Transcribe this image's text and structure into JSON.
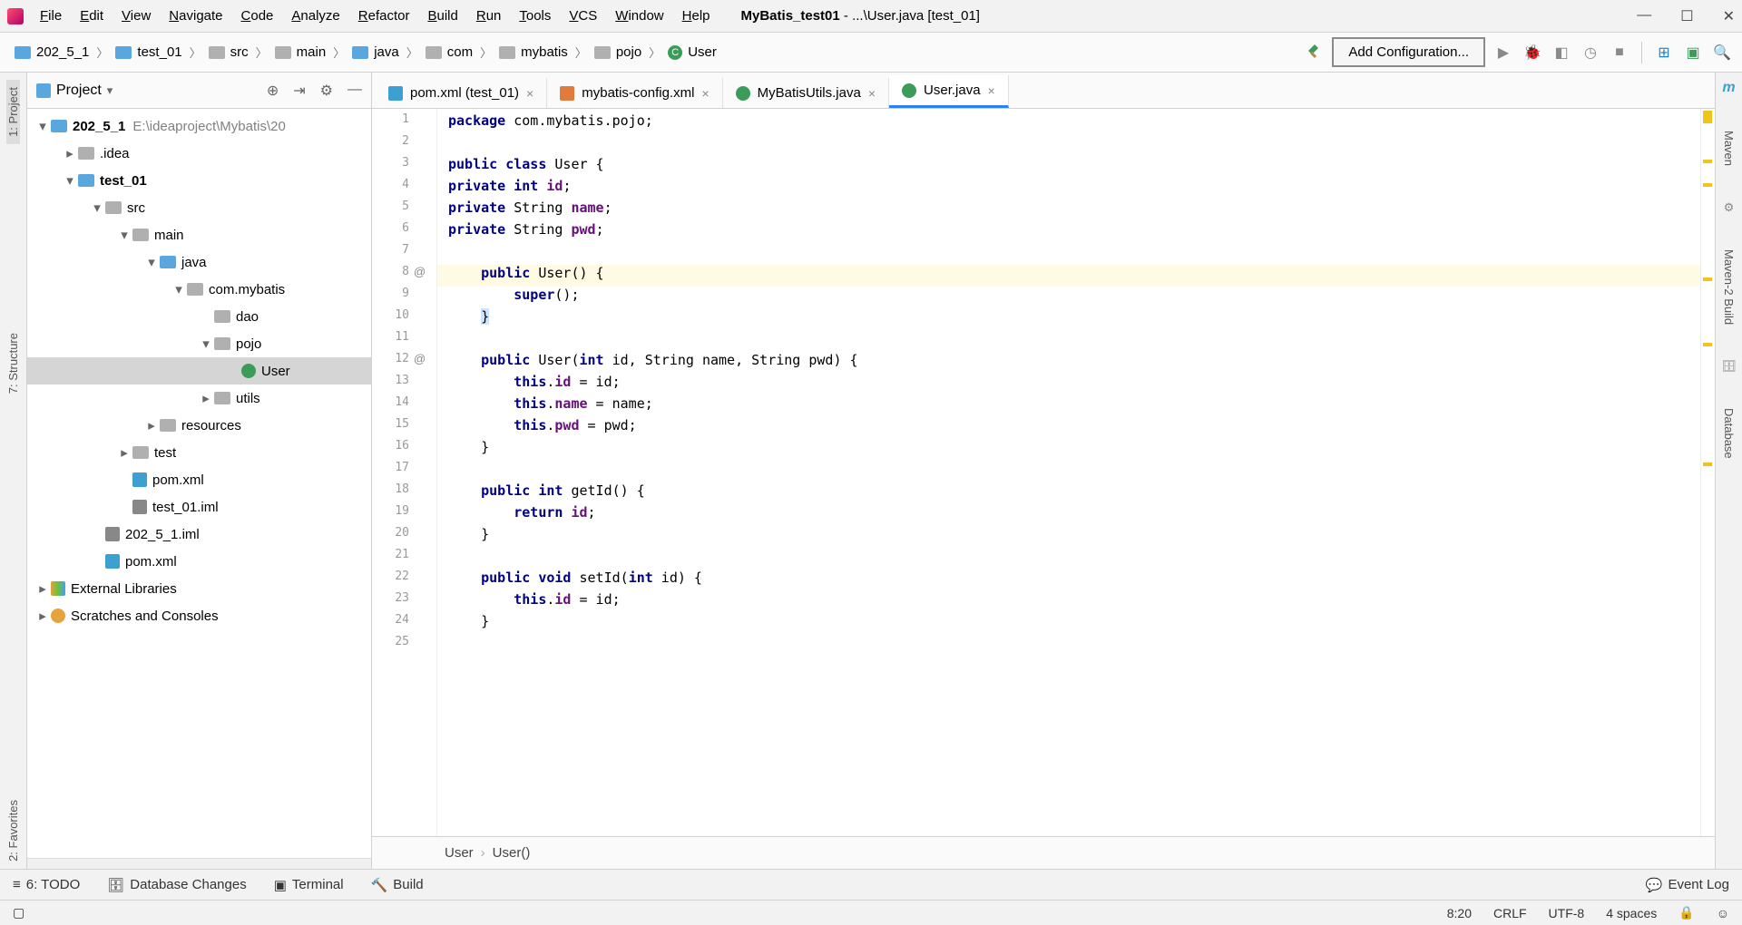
{
  "menu": {
    "items": [
      "File",
      "Edit",
      "View",
      "Navigate",
      "Code",
      "Analyze",
      "Refactor",
      "Build",
      "Run",
      "Tools",
      "VCS",
      "Window",
      "Help"
    ],
    "title_strong": "MyBatis_test01",
    "title_rest": " - ...\\User.java [test_01]"
  },
  "breadcrumb": [
    "202_5_1",
    "test_01",
    "src",
    "main",
    "java",
    "com",
    "mybatis",
    "pojo",
    "User"
  ],
  "toolbar": {
    "config_btn": "Add Configuration..."
  },
  "project": {
    "header": "Project",
    "root_name": "202_5_1",
    "root_hint": "E:\\ideaproject\\Mybatis\\20",
    "tree": [
      {
        "depth": 0,
        "arrow": "▾",
        "name": "202_5_1",
        "bold": true,
        "icon": "folder-blue",
        "hint": "E:\\ideaproject\\Mybatis\\20"
      },
      {
        "depth": 1,
        "arrow": "▸",
        "name": ".idea",
        "icon": "folder"
      },
      {
        "depth": 1,
        "arrow": "▾",
        "name": "test_01",
        "bold": true,
        "icon": "folder-blue"
      },
      {
        "depth": 2,
        "arrow": "▾",
        "name": "src",
        "icon": "folder"
      },
      {
        "depth": 3,
        "arrow": "▾",
        "name": "main",
        "icon": "folder"
      },
      {
        "depth": 4,
        "arrow": "▾",
        "name": "java",
        "icon": "folder-blue"
      },
      {
        "depth": 5,
        "arrow": "▾",
        "name": "com.mybatis",
        "icon": "folder"
      },
      {
        "depth": 6,
        "arrow": "",
        "name": "dao",
        "icon": "folder"
      },
      {
        "depth": 6,
        "arrow": "▾",
        "name": "pojo",
        "icon": "folder"
      },
      {
        "depth": 7,
        "arrow": "",
        "name": "User",
        "icon": "class",
        "selected": true
      },
      {
        "depth": 6,
        "arrow": "▸",
        "name": "utils",
        "icon": "folder"
      },
      {
        "depth": 4,
        "arrow": "▸",
        "name": "resources",
        "icon": "folder"
      },
      {
        "depth": 3,
        "arrow": "▸",
        "name": "test",
        "icon": "folder"
      },
      {
        "depth": 3,
        "arrow": "",
        "name": "pom.xml",
        "icon": "maven"
      },
      {
        "depth": 3,
        "arrow": "",
        "name": "test_01.iml",
        "icon": "iml"
      },
      {
        "depth": 2,
        "arrow": "",
        "name": "202_5_1.iml",
        "icon": "iml"
      },
      {
        "depth": 2,
        "arrow": "",
        "name": "pom.xml",
        "icon": "maven"
      },
      {
        "depth": 0,
        "arrow": "▸",
        "name": "External Libraries",
        "icon": "libs"
      },
      {
        "depth": 0,
        "arrow": "▸",
        "name": "Scratches and Consoles",
        "icon": "scratch"
      }
    ]
  },
  "tabs": [
    {
      "icon": "maven",
      "label": "pom.xml (test_01)",
      "active": false
    },
    {
      "icon": "xml",
      "label": "mybatis-config.xml",
      "active": false
    },
    {
      "icon": "class",
      "label": "MyBatisUtils.java",
      "active": false
    },
    {
      "icon": "class",
      "label": "User.java",
      "active": true
    }
  ],
  "code_lines": [
    {
      "n": 1,
      "html": "<span class='kw'>package</span> com.mybatis.pojo;"
    },
    {
      "n": 2,
      "html": ""
    },
    {
      "n": 3,
      "html": "<span class='kw'>public class</span> <span class='type'>User</span> {"
    },
    {
      "n": 4,
      "html": "<span class='kw'>private int</span> <span class='field'>id</span>;"
    },
    {
      "n": 5,
      "html": "<span class='kw'>private</span> String <span class='field'>name</span>;"
    },
    {
      "n": 6,
      "html": "<span class='kw'>private</span> String <span class='field'>pwd</span>;"
    },
    {
      "n": 7,
      "html": ""
    },
    {
      "n": 8,
      "html": "    <span class='kw'>public</span> <span class='type'>User</span>() {",
      "hl": true,
      "annot": "@"
    },
    {
      "n": 9,
      "html": "        <span class='kw'>super</span>();"
    },
    {
      "n": 10,
      "html": "    <span style='background:#cde6ff'>}</span>"
    },
    {
      "n": 11,
      "html": ""
    },
    {
      "n": 12,
      "html": "    <span class='kw'>public</span> <span class='type'>User</span>(<span class='kw'>int</span> id, String name, String pwd) {",
      "annot": "@"
    },
    {
      "n": 13,
      "html": "        <span class='kw'>this</span>.<span class='field'>id</span> = id;"
    },
    {
      "n": 14,
      "html": "        <span class='kw'>this</span>.<span class='field'>name</span> = name;"
    },
    {
      "n": 15,
      "html": "        <span class='kw'>this</span>.<span class='field'>pwd</span> = pwd;"
    },
    {
      "n": 16,
      "html": "    }"
    },
    {
      "n": 17,
      "html": ""
    },
    {
      "n": 18,
      "html": "    <span class='kw'>public int</span> <span class='type'>getId</span>() {"
    },
    {
      "n": 19,
      "html": "        <span class='kw'>return</span> <span class='field'>id</span>;"
    },
    {
      "n": 20,
      "html": "    }"
    },
    {
      "n": 21,
      "html": ""
    },
    {
      "n": 22,
      "html": "    <span class='kw'>public void</span> <span class='type'>setId</span>(<span class='kw'>int</span> id) {"
    },
    {
      "n": 23,
      "html": "        <span class='kw'>this</span>.<span class='field'>id</span> = id;"
    },
    {
      "n": 24,
      "html": "    }"
    },
    {
      "n": 25,
      "html": ""
    }
  ],
  "editor_breadcrumb": [
    "User",
    "User()"
  ],
  "left_rail": [
    "1: Project",
    "7: Structure",
    "2: Favorites"
  ],
  "right_rail": [
    "Maven",
    "Maven-2 Build",
    "Database"
  ],
  "bottom": {
    "todo": "6: TODO",
    "db": "Database Changes",
    "terminal": "Terminal",
    "build": "Build",
    "eventlog": "Event Log"
  },
  "status": {
    "pos": "8:20",
    "sep": "CRLF",
    "enc": "UTF-8",
    "indent": "4 spaces"
  }
}
